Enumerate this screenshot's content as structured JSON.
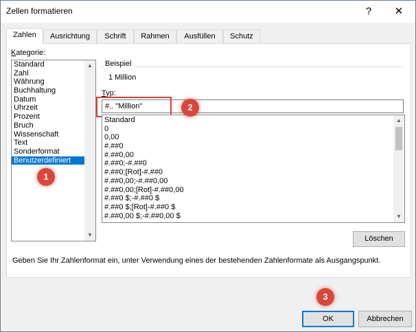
{
  "window": {
    "title": "Zellen formatieren",
    "help_label": "?",
    "close_label": "✕"
  },
  "tabs": [
    {
      "label": "Zahlen"
    },
    {
      "label": "Ausrichtung"
    },
    {
      "label": "Schrift"
    },
    {
      "label": "Rahmen"
    },
    {
      "label": "Ausfüllen"
    },
    {
      "label": "Schutz"
    }
  ],
  "category": {
    "label": "Kategorie:",
    "items": [
      "Standard",
      "Zahl",
      "Währung",
      "Buchhaltung",
      "Datum",
      "Uhrzeit",
      "Prozent",
      "Bruch",
      "Wissenschaft",
      "Text",
      "Sonderformat",
      "Benutzerdefiniert"
    ],
    "selected": "Benutzerdefiniert"
  },
  "sample": {
    "label": "Beispiel",
    "value": "1 Million"
  },
  "type": {
    "label": "Typ:",
    "value": "#.. \"Million\"",
    "formats": [
      "Standard",
      "0",
      "0,00",
      "#.##0",
      "#.##0,00",
      "#.##0;-#.##0",
      "#.##0;[Rot]-#.##0",
      "#.##0,00;-#.##0,00",
      "#.##0,00;[Rot]-#.##0,00",
      "#.##0 $;-#.##0 $",
      "#.##0 $;[Rot]-#.##0 $",
      "#.##0,00 $;-#.##0,00 $"
    ]
  },
  "delete_button": "Löschen",
  "hint": "Geben Sie Ihr Zahlenformat ein, unter Verwendung eines der bestehenden Zahlenformate als Ausgangspunkt.",
  "footer": {
    "ok_label": "OK",
    "cancel_label": "Abbrechen"
  },
  "annotations": {
    "badge1": "1",
    "badge2": "2",
    "badge3": "3"
  },
  "colors": {
    "selection": "#0078d7",
    "annotation": "#d9463b"
  }
}
